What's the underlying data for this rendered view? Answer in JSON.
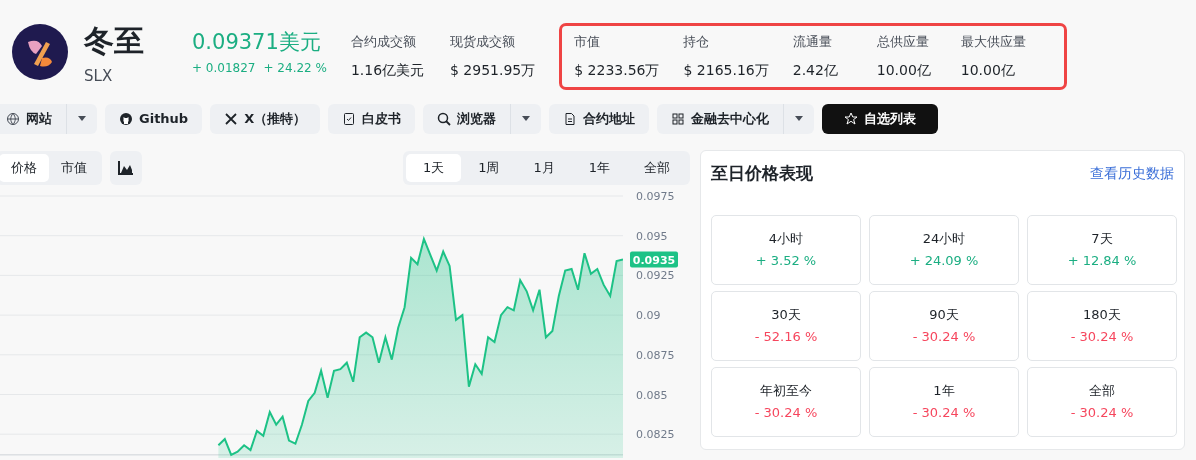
{
  "coin": {
    "name": "冬至",
    "symbol": "SLX"
  },
  "price": {
    "value": "0.09371美元",
    "change": "+ 0.01827",
    "change_pct": "+ 24.22 %"
  },
  "stats": [
    {
      "label": "合约成交额",
      "value": "1.16亿美元"
    },
    {
      "label": "现货成交额",
      "value": "$ 2951.95万"
    }
  ],
  "highlighted_stats": [
    {
      "label": "市值",
      "value": "$ 2233.56万"
    },
    {
      "label": "持仓",
      "value": "$ 2165.16万"
    },
    {
      "label": "流通量",
      "value": "2.42亿"
    },
    {
      "label": "总供应量",
      "value": "10.00亿"
    },
    {
      "label": "最大供应量",
      "value": "10.00亿"
    }
  ],
  "links": [
    {
      "label": "网站",
      "kind": "link",
      "dropdown": true
    },
    {
      "label": "Github",
      "kind": "link",
      "dropdown": false
    },
    {
      "label": "X（推特）",
      "kind": "link",
      "dropdown": false
    },
    {
      "label": "白皮书",
      "kind": "link",
      "dropdown": false
    },
    {
      "label": "浏览器",
      "kind": "link",
      "dropdown": true
    },
    {
      "label": "合约地址",
      "kind": "link",
      "dropdown": false
    },
    {
      "label": "金融去中心化",
      "kind": "link",
      "dropdown": true
    },
    {
      "label": "自选列表",
      "kind": "primary",
      "dropdown": false
    }
  ],
  "chart": {
    "type_tabs": [
      {
        "label": "价格",
        "selected": true
      },
      {
        "label": "市值",
        "selected": false
      }
    ],
    "ranges": [
      {
        "label": "1天",
        "selected": true
      },
      {
        "label": "1周",
        "selected": false
      },
      {
        "label": "1月",
        "selected": false
      },
      {
        "label": "1年",
        "selected": false
      },
      {
        "label": "全部",
        "selected": false
      }
    ],
    "current_price": "0.0935",
    "chart_data": {
      "type": "area",
      "grid": true,
      "ylim": [
        0.0812,
        0.0975
      ],
      "yticks": [
        0.0975,
        0.095,
        0.0925,
        0.09,
        0.0875,
        0.085,
        0.0825
      ],
      "series": [
        {
          "color": "#1dc286",
          "values": [
            null,
            null,
            null,
            null,
            null,
            null,
            null,
            null,
            null,
            null,
            null,
            null,
            null,
            null,
            null,
            null,
            null,
            null,
            null,
            null,
            null,
            null,
            null,
            null,
            null,
            null,
            null,
            null,
            null,
            null,
            null,
            null,
            null,
            null,
            0.0818,
            0.0822,
            0.0812,
            0.0814,
            0.0818,
            0.0815,
            0.0827,
            0.0824,
            0.0839,
            0.0831,
            0.0836,
            0.0821,
            0.0819,
            0.0831,
            0.0846,
            0.0851,
            0.0865,
            0.0848,
            0.0865,
            0.0866,
            0.087,
            0.0858,
            0.0886,
            0.0889,
            0.0886,
            0.087,
            0.0886,
            0.0872,
            0.0892,
            0.0905,
            0.0936,
            0.0932,
            0.0948,
            0.0938,
            0.0928,
            0.094,
            0.0931,
            0.0897,
            0.09,
            0.0855,
            0.0869,
            0.0863,
            0.0886,
            0.0883,
            0.09,
            0.0905,
            0.0903,
            0.0922,
            0.0915,
            0.0903,
            0.0916,
            0.0886,
            0.089,
            0.0912,
            0.0928,
            0.0929,
            0.0916,
            0.0939,
            0.0926,
            0.0929,
            0.0919,
            0.0912,
            0.0934,
            0.0935
          ]
        }
      ]
    }
  },
  "performance": {
    "title": "至日价格表现",
    "link": "查看历史数据",
    "periods": [
      {
        "label": "4小时",
        "change": "+ 3.52 %",
        "color": "#1bae82"
      },
      {
        "label": "24小时",
        "change": "+ 24.09 %",
        "color": "#1bae82"
      },
      {
        "label": "7天",
        "change": "+ 12.84 %",
        "color": "#1bae82"
      },
      {
        "label": "30天",
        "change": "- 52.16 %",
        "color": "#f6465d"
      },
      {
        "label": "90天",
        "change": "- 30.24 %",
        "color": "#f6465d"
      },
      {
        "label": "180天",
        "change": "- 30.24 %",
        "color": "#f6465d"
      },
      {
        "label": "年初至今",
        "change": "- 30.24 %",
        "color": "#f6465d"
      },
      {
        "label": "1年",
        "change": "- 30.24 %",
        "color": "#f6465d"
      },
      {
        "label": "全部",
        "change": "- 30.24 %",
        "color": "#f6465d"
      }
    ]
  }
}
